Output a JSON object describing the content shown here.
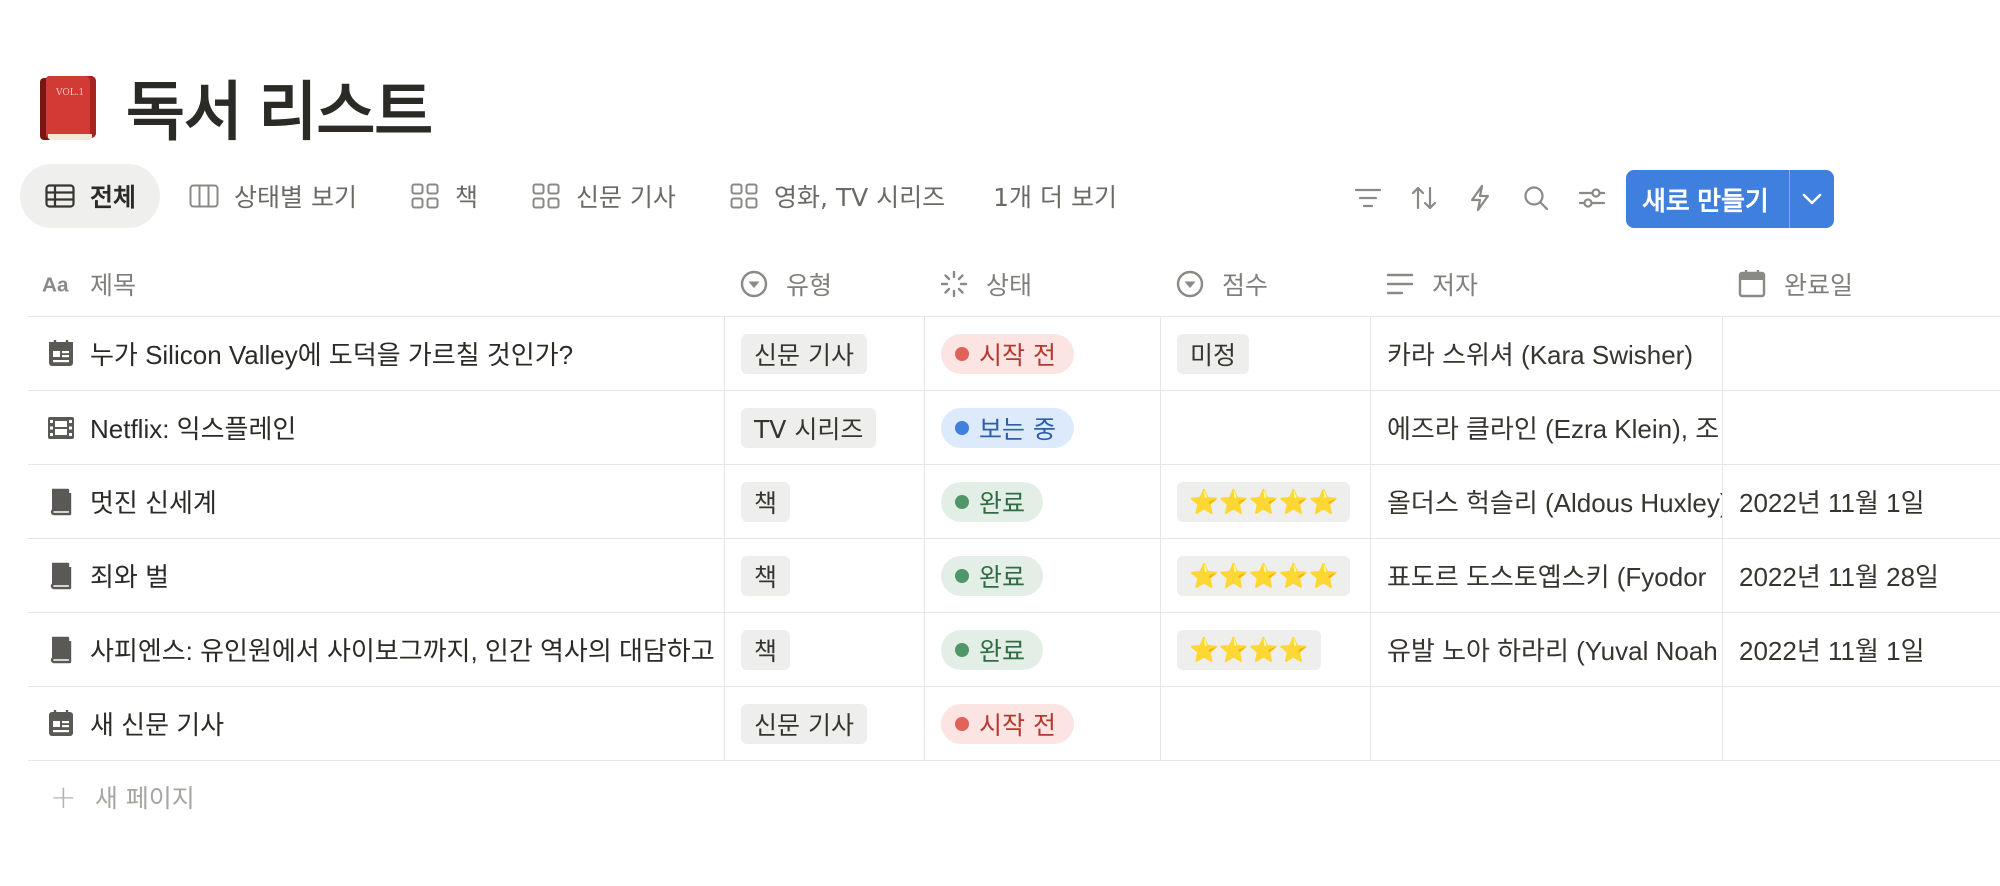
{
  "page": {
    "title": "독서 리스트",
    "emoji_label": "VOL.1"
  },
  "views": [
    {
      "label": "전체",
      "icon": "table-icon"
    },
    {
      "label": "상태별 보기",
      "icon": "board-icon"
    },
    {
      "label": "책",
      "icon": "gallery-icon"
    },
    {
      "label": "신문 기사",
      "icon": "gallery-icon"
    },
    {
      "label": "영화, TV 시리즈",
      "icon": "gallery-icon"
    },
    {
      "label": "1개 더 보기",
      "icon": ""
    }
  ],
  "toolbar": {
    "icons": [
      "filter-icon",
      "sort-icon",
      "automation-icon",
      "search-icon",
      "settings-icon"
    ],
    "new_label": "새로 만들기"
  },
  "columns": [
    {
      "label": "제목",
      "icon": "title-icon"
    },
    {
      "label": "유형",
      "icon": "select-icon"
    },
    {
      "label": "상태",
      "icon": "status-icon"
    },
    {
      "label": "점수",
      "icon": "select-icon"
    },
    {
      "label": "저자",
      "icon": "text-icon"
    },
    {
      "label": "완료일",
      "icon": "calendar-icon"
    }
  ],
  "rows": [
    {
      "title": "누가 Silicon Valley에 도덕을 가르칠 것인가?",
      "icon": "article-icon",
      "type": "신문 기사",
      "status": "시작 전",
      "status_color": "#e16259",
      "status_bg": "#fbe4e2",
      "score": "미정",
      "author": "카라 스위셔 (Kara Swisher)",
      "date": ""
    },
    {
      "title": "Netflix: 익스플레인",
      "icon": "film-icon",
      "type": "TV 시리즈",
      "status": "보는 중",
      "status_color": "#3f7fdd",
      "status_bg": "#dceafb",
      "score": "",
      "author": "에즈라 클라인 (Ezra Klein), 조",
      "date": ""
    },
    {
      "title": "멋진 신세계",
      "icon": "book-icon",
      "type": "책",
      "status": "완료",
      "status_color": "#4f9768",
      "status_bg": "#e3efe6",
      "score": "⭐⭐⭐⭐⭐",
      "author": "올더스 헉슬리 (Aldous Huxley)",
      "date": "2022년 11월 1일"
    },
    {
      "title": "죄와 벌",
      "icon": "book-icon",
      "type": "책",
      "status": "완료",
      "status_color": "#4f9768",
      "status_bg": "#e3efe6",
      "score": "⭐⭐⭐⭐⭐",
      "author": "표도르 도스토옙스키 (Fyodor",
      "date": "2022년 11월 28일"
    },
    {
      "title": "사피엔스: 유인원에서 사이보그까지, 인간 역사의 대담하고",
      "icon": "book-icon",
      "type": "책",
      "status": "완료",
      "status_color": "#4f9768",
      "status_bg": "#e3efe6",
      "score": "⭐⭐⭐⭐",
      "author": "유발 노아 하라리 (Yuval Noah",
      "date": "2022년 11월 1일"
    },
    {
      "title": "새 신문 기사",
      "icon": "article-icon",
      "type": "신문 기사",
      "status": "시작 전",
      "status_color": "#e16259",
      "status_bg": "#fbe4e2",
      "score": "",
      "author": "",
      "date": ""
    }
  ],
  "add_row_label": "새 페이지"
}
